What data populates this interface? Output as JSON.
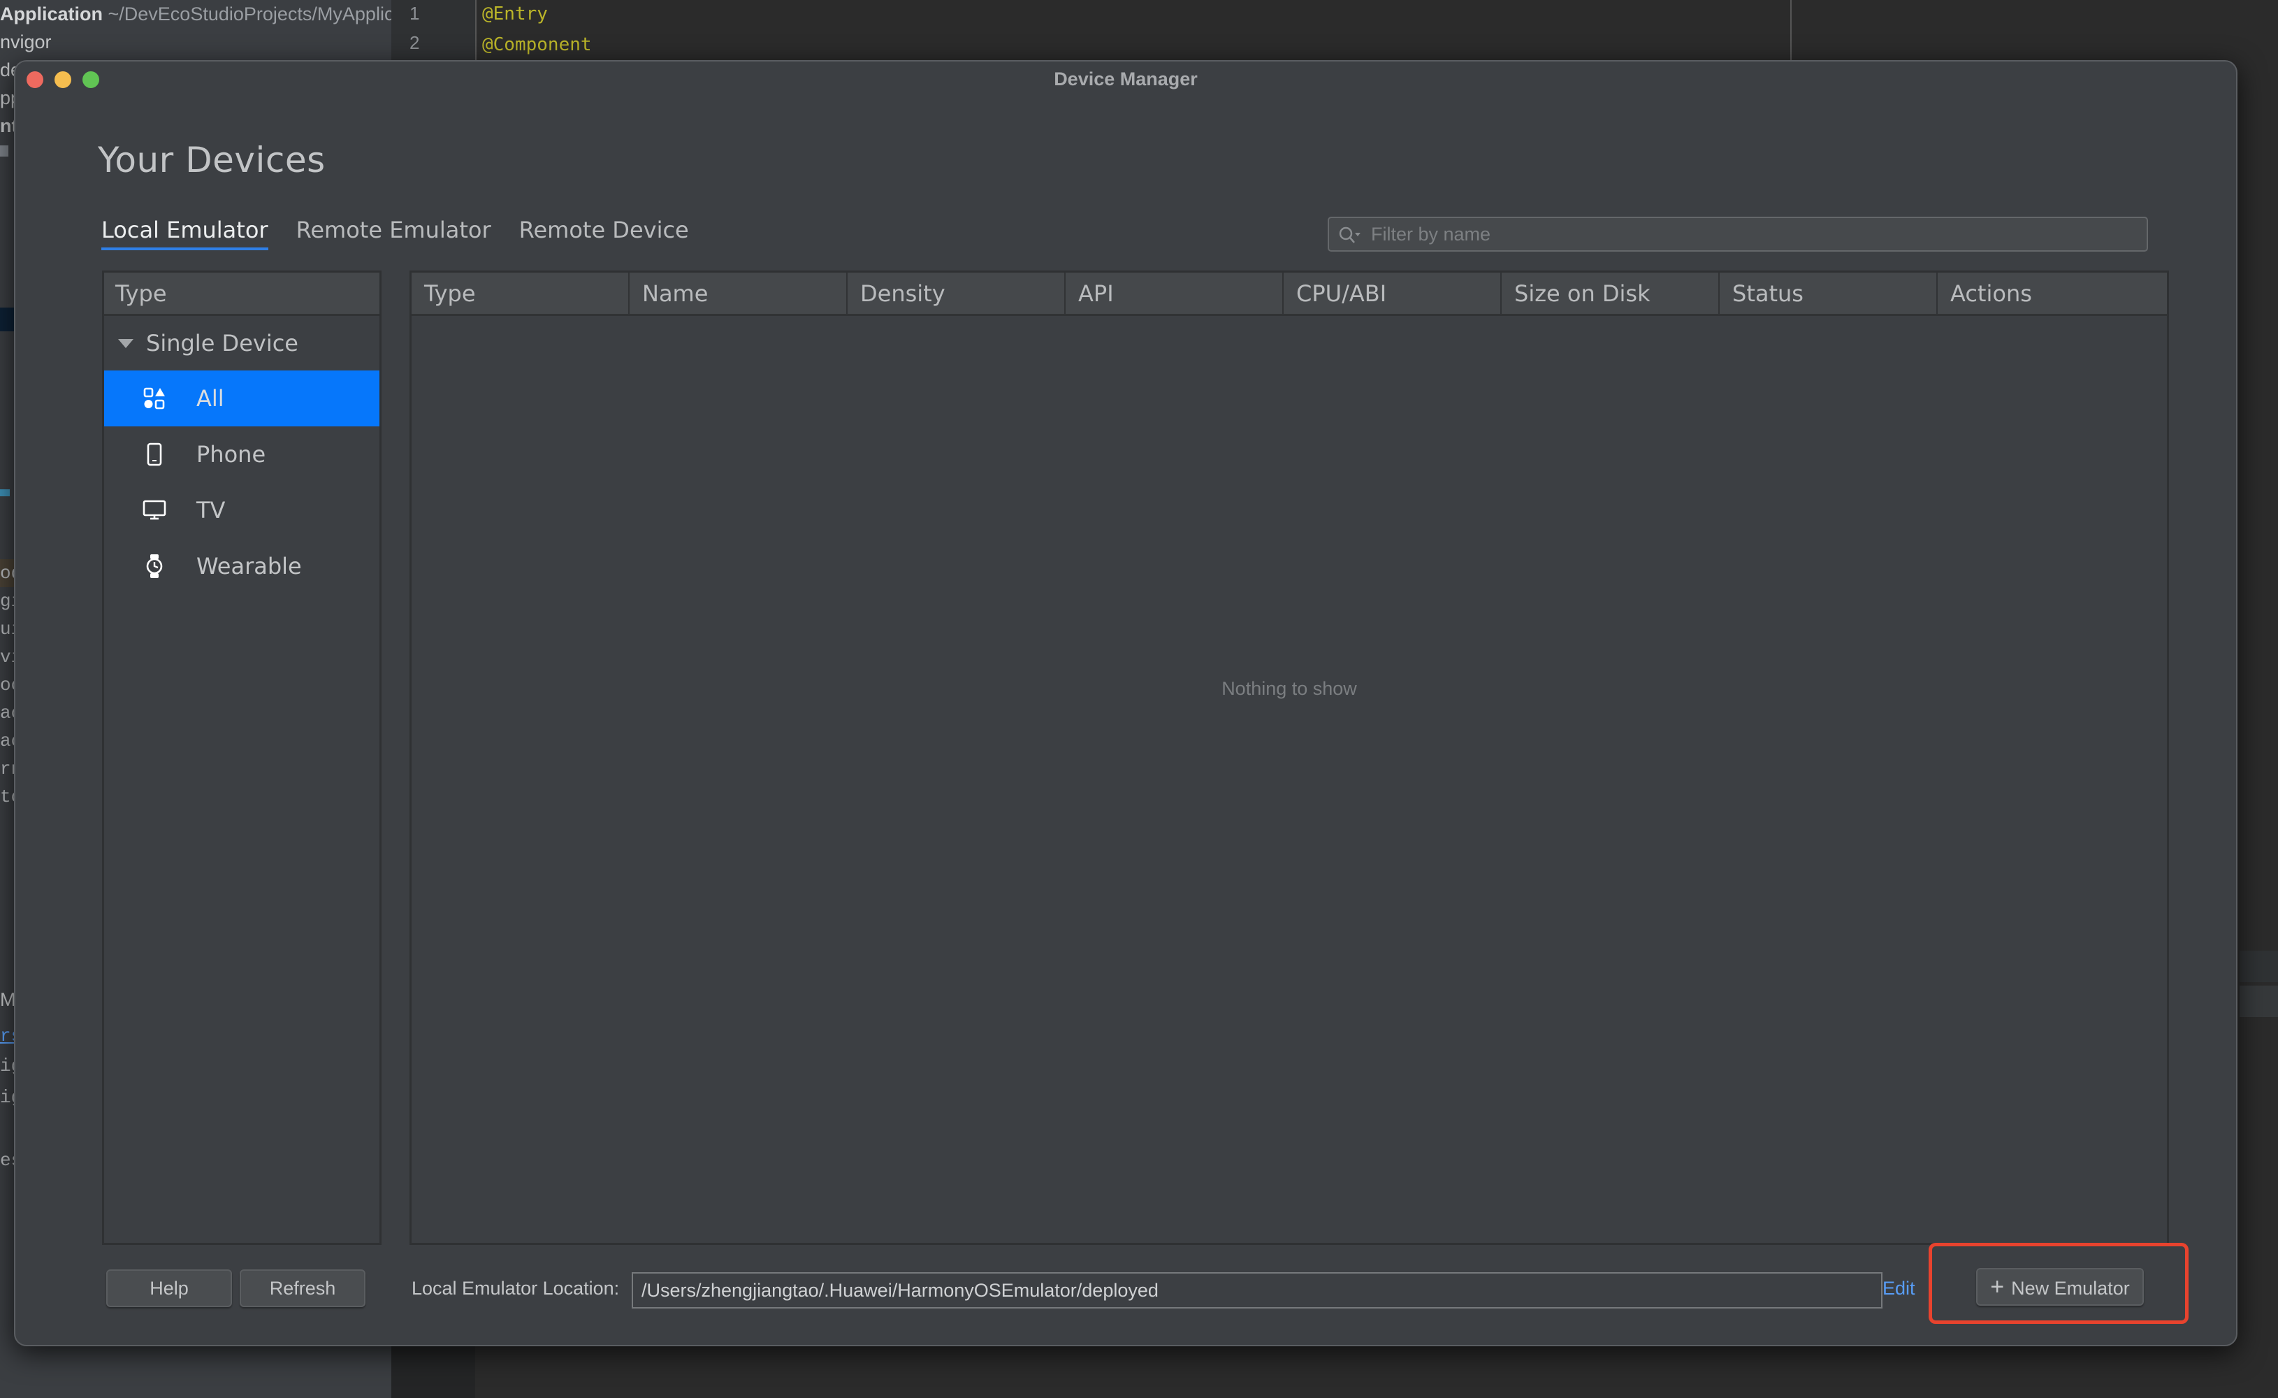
{
  "background_ide": {
    "project_name": "Application",
    "project_path": "~/DevEcoStudioProjects/MyApplicat",
    "tree_fragments": [
      "nvigor",
      "de",
      "pp",
      "nt",
      "od",
      "git",
      "ui",
      "vi",
      "oc",
      "ac",
      "ac",
      "rn",
      "tc",
      "M",
      "rs",
      "ig",
      "ig",
      "es"
    ],
    "line_numbers": [
      "1",
      "2"
    ],
    "code_lines": [
      "@Entry",
      "@Component"
    ]
  },
  "dialog": {
    "title": "Device Manager",
    "heading": "Your Devices",
    "tabs": [
      {
        "label": "Local Emulator",
        "active": true
      },
      {
        "label": "Remote Emulator",
        "active": false
      },
      {
        "label": "Remote Device",
        "active": false
      }
    ],
    "filter": {
      "placeholder": "Filter by name",
      "value": ""
    },
    "type_panel": {
      "header": "Type",
      "group": "Single Device",
      "items": [
        {
          "label": "All",
          "icon": "all-categories-icon",
          "selected": true
        },
        {
          "label": "Phone",
          "icon": "phone-icon",
          "selected": false
        },
        {
          "label": "TV",
          "icon": "tv-icon",
          "selected": false
        },
        {
          "label": "Wearable",
          "icon": "watch-icon",
          "selected": false
        }
      ]
    },
    "table": {
      "columns": [
        "Type",
        "Name",
        "Density",
        "API",
        "CPU/ABI",
        "Size on Disk",
        "Status",
        "Actions"
      ],
      "rows": [],
      "empty_text": "Nothing to show"
    },
    "footer": {
      "help_label": "Help",
      "refresh_label": "Refresh",
      "location_label": "Local Emulator Location:",
      "location_value": "/Users/zhengjiangtao/.Huawei/HarmonyOSEmulator/deployed",
      "edit_label": "Edit",
      "new_emulator_label": "New Emulator"
    }
  },
  "colors": {
    "accent": "#0677fb",
    "tab_underline": "#2f7fe6",
    "link": "#589df6",
    "highlight": "#e8432e"
  }
}
